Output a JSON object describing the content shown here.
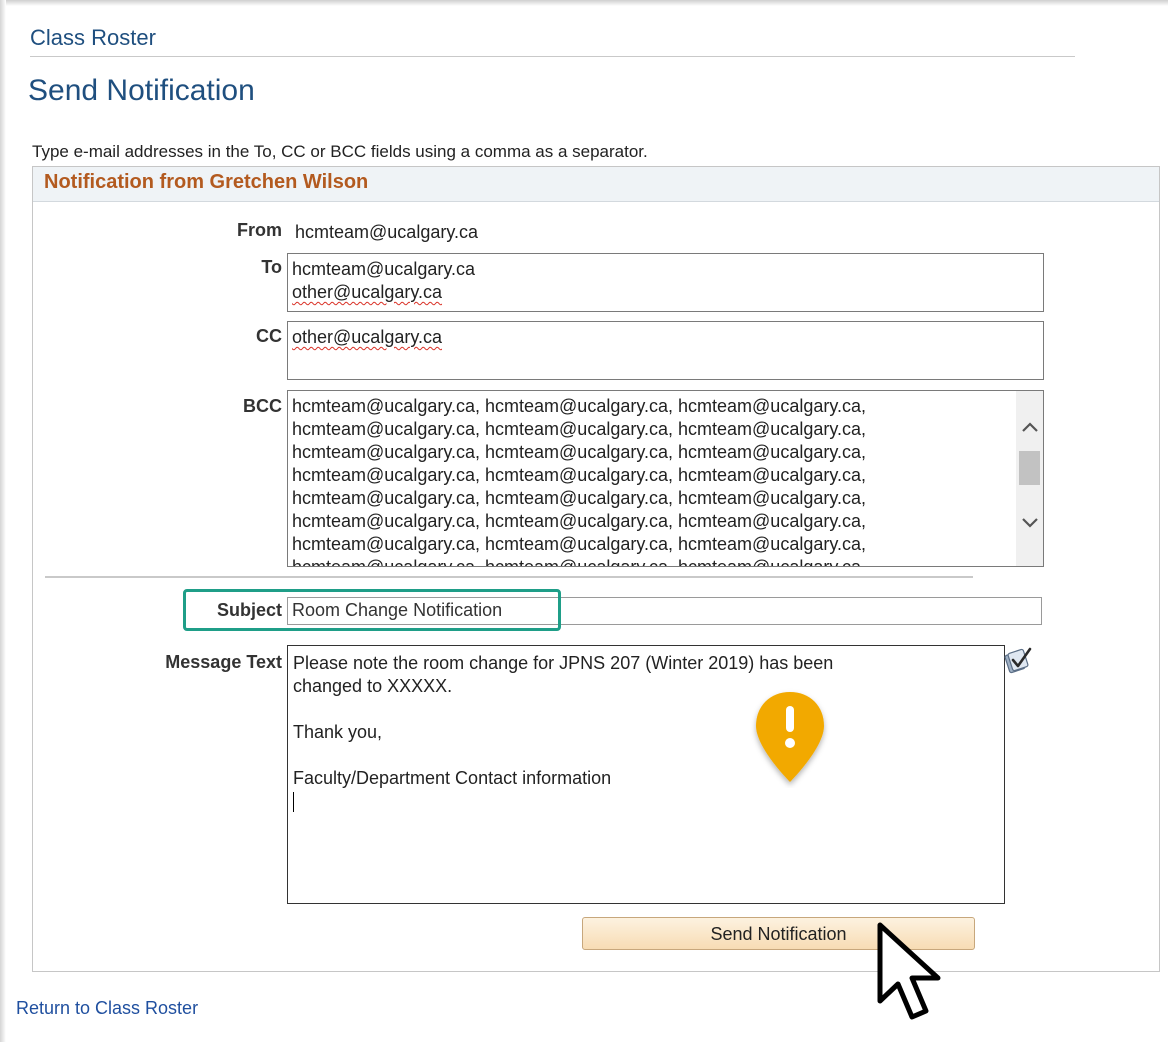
{
  "breadcrumb": "Class Roster",
  "page_title": "Send Notification",
  "instructions": "Type e-mail addresses in the To, CC or BCC fields using a comma as a separator.",
  "group_title": "Notification from Gretchen Wilson",
  "labels": {
    "from": "From",
    "to": "To",
    "cc": "CC",
    "bcc": "BCC",
    "subject": "Subject",
    "message": "Message Text"
  },
  "from_value": "hcmteam@ucalgary.ca",
  "to_lines": [
    "hcmteam@ucalgary.ca",
    "other@ucalgary.ca"
  ],
  "cc_lines": [
    "other@ucalgary.ca"
  ],
  "bcc_lines": [
    "hcmteam@ucalgary.ca, hcmteam@ucalgary.ca, hcmteam@ucalgary.ca,",
    "hcmteam@ucalgary.ca, hcmteam@ucalgary.ca, hcmteam@ucalgary.ca,",
    "hcmteam@ucalgary.ca, hcmteam@ucalgary.ca, hcmteam@ucalgary.ca,",
    "hcmteam@ucalgary.ca, hcmteam@ucalgary.ca, hcmteam@ucalgary.ca,",
    "hcmteam@ucalgary.ca, hcmteam@ucalgary.ca, hcmteam@ucalgary.ca,",
    "hcmteam@ucalgary.ca, hcmteam@ucalgary.ca, hcmteam@ucalgary.ca,",
    "hcmteam@ucalgary.ca, hcmteam@ucalgary.ca, hcmteam@ucalgary.ca,",
    "hcmteam@ucalgary.ca, hcmteam@ucalgary.ca, hcmteam@ucalgary.ca,"
  ],
  "subject_value": "Room Change Notification",
  "message": {
    "line1": "Please note the room change for JPNS 207 (Winter 2019) has been",
    "line2": "changed to XXXXX.",
    "line3": "Thank you,",
    "line4": "Faculty/Department Contact information"
  },
  "send_button": "Send Notification",
  "return_link": "Return to Class Roster",
  "icons": {
    "spell_check": "spell-check-icon",
    "scroll_up": "chevron-up-icon",
    "scroll_down": "chevron-down-icon",
    "alert_pin": "alert-pin-icon",
    "cursor": "mouse-pointer-icon"
  },
  "colors": {
    "link_blue": "#1f4f7f",
    "group_title": "#b35a1f",
    "highlight": "#1f9e88",
    "alert_pin": "#f2a900"
  }
}
